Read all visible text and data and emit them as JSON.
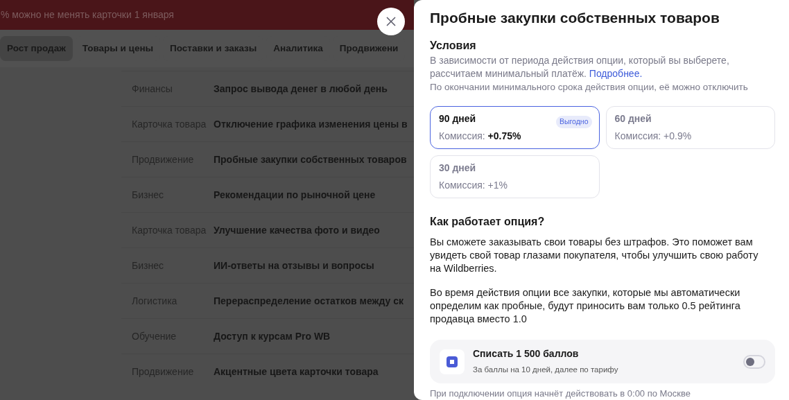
{
  "banner": {
    "text": "% можно не менять карточки 1 января"
  },
  "nav_tabs": [
    {
      "label": "Рост продаж",
      "selected": true
    },
    {
      "label": "Товары и цены",
      "selected": false
    },
    {
      "label": "Поставки и заказы",
      "selected": false
    },
    {
      "label": "Аналитика",
      "selected": false
    },
    {
      "label": "Продвижени",
      "selected": false
    }
  ],
  "options_table": {
    "rows": [
      {
        "category": "Финансы",
        "name": "Запрос вывода денег в любой день"
      },
      {
        "category": "Карточка товара",
        "name": "Отключение графика изменения цены в"
      },
      {
        "category": "Продвижение",
        "name": "Пробные закупки собственных товаров"
      },
      {
        "category": "Бизнес",
        "name": "Рекомендации по рыночной цене"
      },
      {
        "category": "Карточка товара",
        "name": "Улучшение качества фото и видео"
      },
      {
        "category": "Бизнес",
        "name": "ИИ-ответы на отзывы и вопросы"
      },
      {
        "category": "Логистика",
        "name": "Перераспределение остатков между ск"
      },
      {
        "category": "Обучение",
        "name": "Доступ к курсам Pro WB"
      },
      {
        "category": "Продвижение",
        "name": "Акцентные цвета карточки товара"
      }
    ]
  },
  "panel": {
    "title": "Пробные закупки собственных товаров",
    "conditions": {
      "heading": "Условия",
      "text": "В зависимости от периода действия опции, который вы выберете, рассчитаем минимальный платёж.",
      "link": "Подробнее.",
      "note": "По окончании минимального срока действия опции, её можно отключить"
    },
    "periods": [
      {
        "label": "90 дней",
        "commission_label": "Комиссия:",
        "commission": "+0.75%",
        "badge": "Выгодно",
        "selected": true
      },
      {
        "label": "60 дней",
        "commission_label": "Комиссия:",
        "commission": "+0.9%",
        "selected": false
      },
      {
        "label": "30 дней",
        "commission_label": "Комиссия:",
        "commission": "+1%",
        "selected": false
      }
    ],
    "how": {
      "heading": "Как работает опция?",
      "paragraphs": [
        "Вы сможете заказывать свои товары без штрафов. Это поможет вам увидеть свой товар глазами покупателя, чтобы улучшить свою работу на Wildberries.",
        "Во время действия опции все закупки, которые мы автоматически определим как пробные, будут приносить вам только 0.5 рейтинга продавца вместо 1.0"
      ]
    },
    "points": {
      "title": "Списать 1 500 баллов",
      "subtitle": "За баллы на 10 дней, далее по тарифу",
      "on": false
    },
    "footer_text": "При подключении опция начнёт действовать в 0:00 по Москве"
  }
}
